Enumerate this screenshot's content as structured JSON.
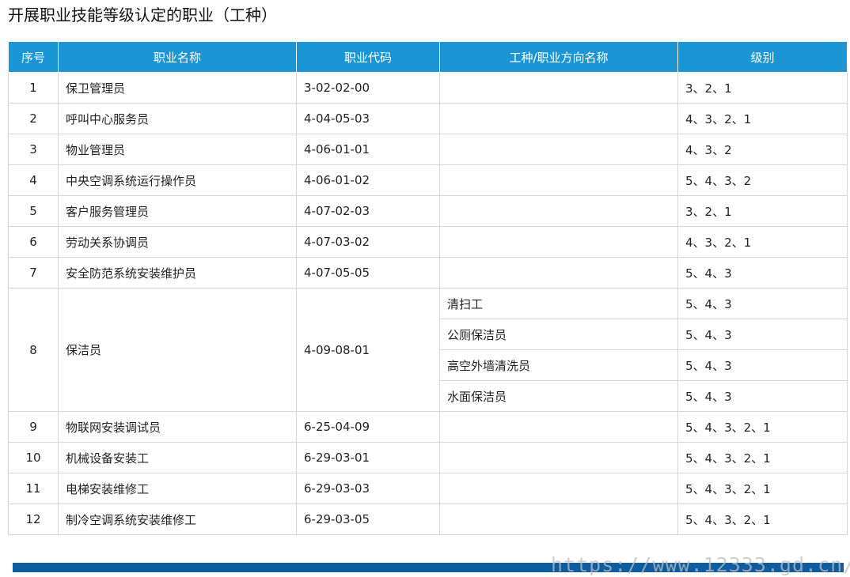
{
  "title": "开展职业技能等级认定的职业（工种）",
  "columns": [
    "序号",
    "职业名称",
    "职业代码",
    "工种/职业方向名称",
    "级别"
  ],
  "rows": [
    {
      "no": "1",
      "name": "保卫管理员",
      "code": "3-02-02-00",
      "subtypes": [
        {
          "name": "",
          "levels": "3、2、1"
        }
      ]
    },
    {
      "no": "2",
      "name": "呼叫中心服务员",
      "code": "4-04-05-03",
      "subtypes": [
        {
          "name": "",
          "levels": "4、3、2、1"
        }
      ]
    },
    {
      "no": "3",
      "name": "物业管理员",
      "code": "4-06-01-01",
      "subtypes": [
        {
          "name": "",
          "levels": "4、3、2"
        }
      ]
    },
    {
      "no": "4",
      "name": "中央空调系统运行操作员",
      "code": "4-06-01-02",
      "subtypes": [
        {
          "name": "",
          "levels": "5、4、3、2"
        }
      ]
    },
    {
      "no": "5",
      "name": "客户服务管理员",
      "code": "4-07-02-03",
      "subtypes": [
        {
          "name": "",
          "levels": "3、2、1"
        }
      ]
    },
    {
      "no": "6",
      "name": "劳动关系协调员",
      "code": "4-07-03-02",
      "subtypes": [
        {
          "name": "",
          "levels": "4、3、2、1"
        }
      ]
    },
    {
      "no": "7",
      "name": "安全防范系统安装维护员",
      "code": "4-07-05-05",
      "subtypes": [
        {
          "name": "",
          "levels": "5、4、3"
        }
      ]
    },
    {
      "no": "8",
      "name": "保洁员",
      "code": "4-09-08-01",
      "subtypes": [
        {
          "name": "清扫工",
          "levels": "5、4、3"
        },
        {
          "name": "公厕保洁员",
          "levels": "5、4、3"
        },
        {
          "name": "高空外墙清洗员",
          "levels": "5、4、3"
        },
        {
          "name": "水面保洁员",
          "levels": "5、4、3"
        }
      ]
    },
    {
      "no": "9",
      "name": "物联网安装调试员",
      "code": "6-25-04-09",
      "subtypes": [
        {
          "name": "",
          "levels": "5、4、3、2、1"
        }
      ]
    },
    {
      "no": "10",
      "name": "机械设备安装工",
      "code": "6-29-03-01",
      "subtypes": [
        {
          "name": "",
          "levels": "5、4、3、2、1"
        }
      ]
    },
    {
      "no": "11",
      "name": "电梯安装维修工",
      "code": "6-29-03-03",
      "subtypes": [
        {
          "name": "",
          "levels": "5、4、3、2、1"
        }
      ]
    },
    {
      "no": "12",
      "name": "制冷空调系统安装维修工",
      "code": "6-29-03-05",
      "subtypes": [
        {
          "name": "",
          "levels": "5、4、3、2、1"
        }
      ]
    }
  ],
  "watermark": "https://www.12333.gd.cn/",
  "colors": {
    "header_bg": "#1a96d4",
    "footer_bar": "#0f5c9e"
  }
}
